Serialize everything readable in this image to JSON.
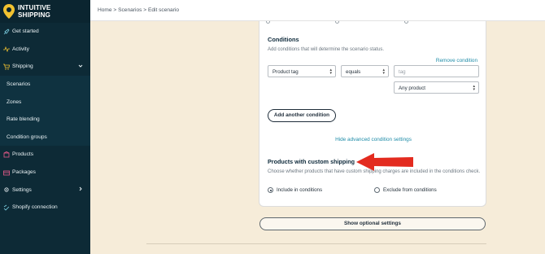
{
  "brand": {
    "line1": "INTUITIVE",
    "line2": "SHIPPING",
    "logo_color": "#f2c230"
  },
  "sidebar": {
    "items": [
      {
        "label": "Get started",
        "icon": "rocket-icon"
      },
      {
        "label": "Activity",
        "icon": "activity-icon"
      },
      {
        "label": "Shipping",
        "icon": "cart-icon",
        "expanded": true
      },
      {
        "label": "Scenarios"
      },
      {
        "label": "Zones"
      },
      {
        "label": "Rate blending"
      },
      {
        "label": "Condition groups"
      },
      {
        "label": "Products",
        "icon": "box-icon"
      },
      {
        "label": "Packages",
        "icon": "package-icon"
      },
      {
        "label": "Settings",
        "icon": "gear-icon"
      },
      {
        "label": "Shopify connection",
        "icon": "link-icon"
      }
    ]
  },
  "breadcrumb": "Home > Scenarios > Edit scenario",
  "conditions": {
    "title": "Conditions",
    "subtitle": "Add conditions that will determine the scenario status.",
    "remove_label": "Remove condition",
    "field_select": "Product tag",
    "operator_select": "equals",
    "value_placeholder": "tag",
    "scope_select": "Any product",
    "add_button": "Add another condition",
    "hide_advanced": "Hide advanced condition settings"
  },
  "custom_shipping": {
    "title": "Products with custom shipping",
    "description": "Choose whether products that have custom shipping charges are included in the conditions check.",
    "option_include": "Include in conditions",
    "option_exclude": "Exclude from conditions",
    "selected": "include"
  },
  "optional_settings_button": "Show optional settings",
  "colors": {
    "sidebar_bg": "#0d2a36",
    "page_bg": "#f6ecd9",
    "link": "#1f8ca8",
    "arrow": "#e32b1f"
  }
}
